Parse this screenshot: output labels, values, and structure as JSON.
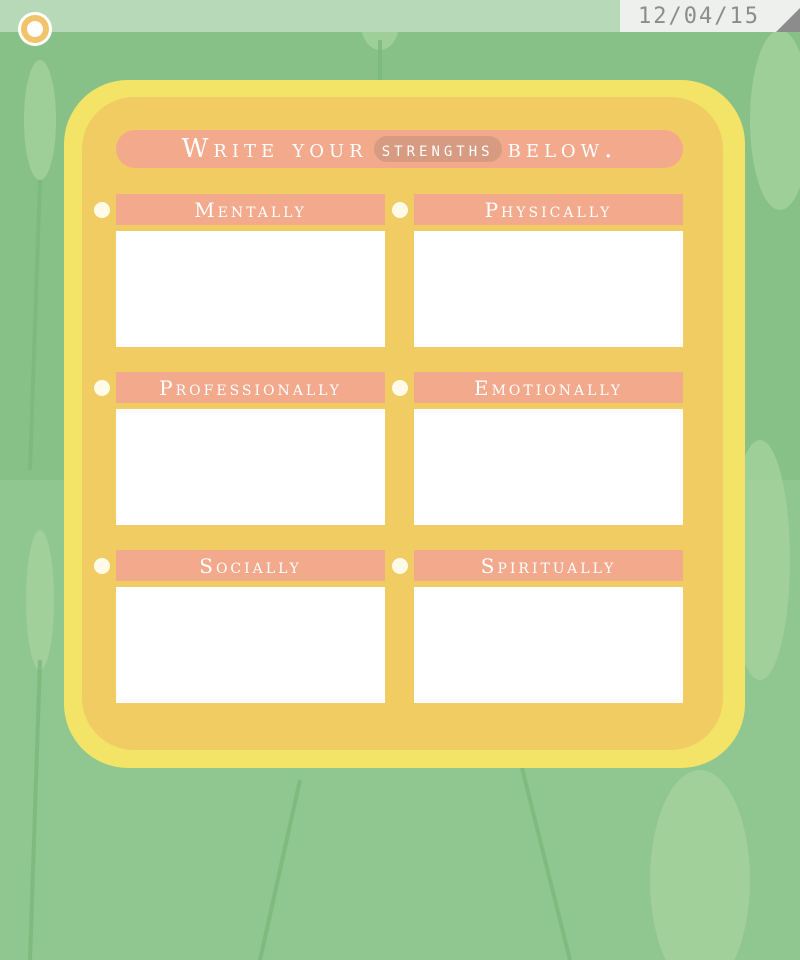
{
  "header": {
    "date": "12/04/15"
  },
  "prompt": {
    "before": "Write your",
    "highlight": "strengths",
    "after": "below."
  },
  "sections": [
    {
      "label": "Mentally"
    },
    {
      "label": "Physically"
    },
    {
      "label": "Professionally"
    },
    {
      "label": "Emotionally"
    },
    {
      "label": "Socially"
    },
    {
      "label": "Spiritually"
    }
  ],
  "colors": {
    "background_green": "#8dc48d",
    "card_outer": "#f3e468",
    "card_inner": "#f0cc62",
    "label_salmon": "#f2a98c"
  },
  "icons": {
    "menu": "menu-circle-icon",
    "bullet": "bullet-dot-icon"
  }
}
